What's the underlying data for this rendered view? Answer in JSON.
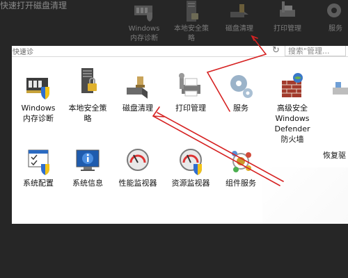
{
  "background": {
    "title": "快速打开磁盘清理",
    "items": [
      {
        "label_1": "Windows",
        "label_2": "内存诊断",
        "icon": "memory-diagnostic-icon"
      },
      {
        "label_1": "本地安全策",
        "label_2": "略",
        "icon": "local-security-policy-icon"
      },
      {
        "label_1": "磁盘清理",
        "label_2": "",
        "icon": "disk-cleanup-icon"
      },
      {
        "label_1": "打印管理",
        "label_2": "",
        "icon": "print-management-icon"
      },
      {
        "label_1": "服务",
        "label_2": "",
        "icon": "services-icon"
      }
    ]
  },
  "address_bar": {
    "text": "快速诊",
    "refresh_icon": "refresh-icon",
    "search_placeholder": "搜索\"管理..."
  },
  "tools": [
    {
      "label": "Windows\n内存诊断",
      "icon": "memory-diagnostic-icon"
    },
    {
      "label": "本地安全策\n略",
      "icon": "local-security-policy-icon"
    },
    {
      "label": "磁盘清理",
      "icon": "disk-cleanup-icon"
    },
    {
      "label": "打印管理",
      "icon": "print-management-icon"
    },
    {
      "label": "服务",
      "icon": "services-icon"
    },
    {
      "label": "高级安全\nWindows\nDefender\n防火墙",
      "icon": "firewall-icon"
    },
    {
      "label": "恢复驱",
      "icon": "recovery-drive-icon"
    },
    {
      "label": "系统配置",
      "icon": "system-configuration-icon"
    },
    {
      "label": "系统信息",
      "icon": "system-information-icon"
    },
    {
      "label": "性能监视器",
      "icon": "performance-monitor-icon"
    },
    {
      "label": "资源监视器",
      "icon": "resource-monitor-icon"
    },
    {
      "label": "组件服务",
      "icon": "component-services-icon"
    }
  ],
  "annotation": {
    "color": "#d62222",
    "target": "磁盘清理"
  }
}
